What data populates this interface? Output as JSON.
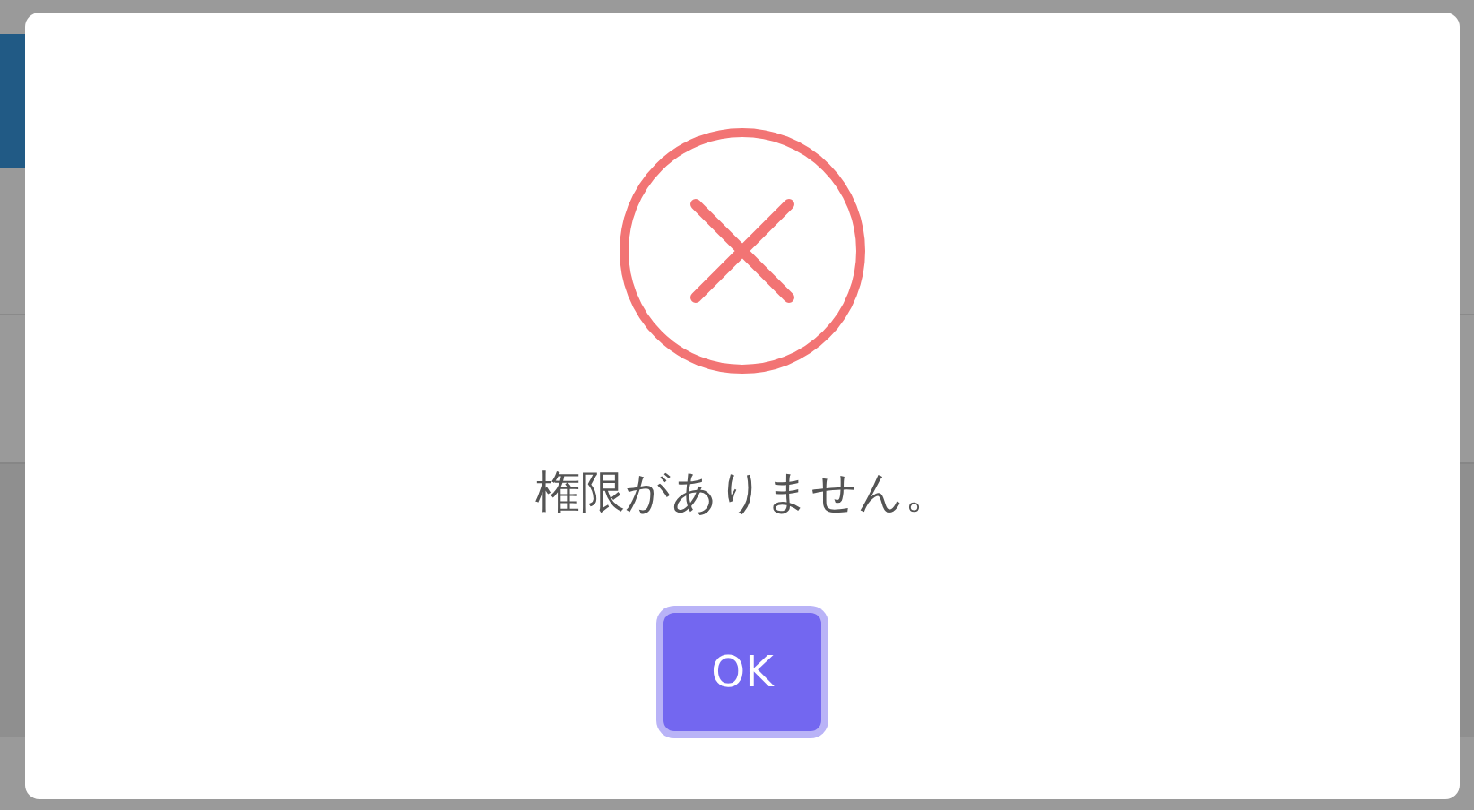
{
  "dialog": {
    "kind": "error",
    "message": "権限がありません。",
    "button": {
      "label": "OK",
      "focused": true
    }
  }
}
